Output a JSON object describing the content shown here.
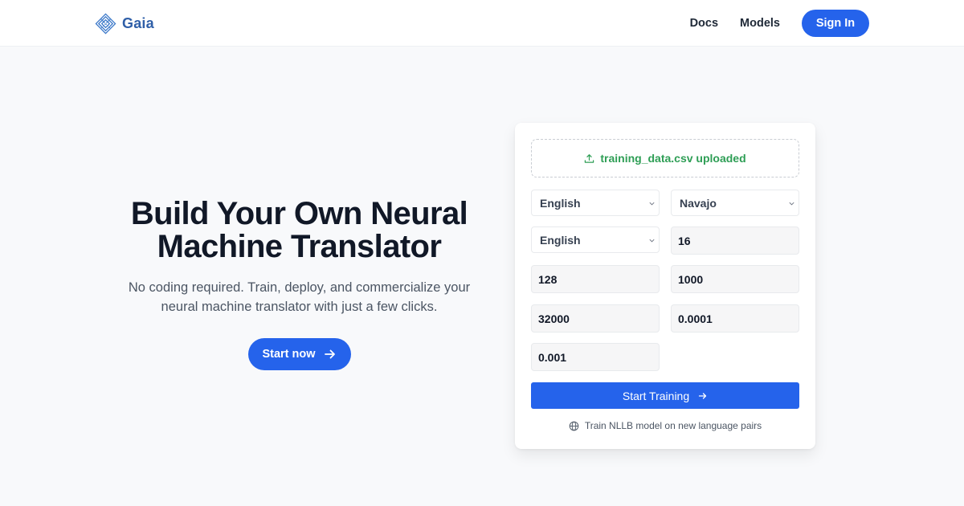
{
  "navbar": {
    "brand": {
      "name": "Gaia",
      "icon": "diamond-grid-logo-icon",
      "color": "#2f5fa8"
    },
    "links": [
      {
        "label": "Docs"
      },
      {
        "label": "Models"
      }
    ],
    "signin_label": "Sign In"
  },
  "hero": {
    "title_line1": "Build Your Own Neural",
    "title_line2": "Machine Translator",
    "subtitle_line1": "No coding required. Train, deploy, and commercialize your",
    "subtitle_line2": "neural machine translator with just a few clicks.",
    "cta_label": "Start now",
    "cta_icon": "arrow-right-icon"
  },
  "training_form": {
    "upload": {
      "icon": "upload-icon",
      "status": "training_data.csv uploaded",
      "color": "#2e9e55"
    },
    "selects": {
      "source_language": "English",
      "target_language": "Navajo",
      "pivot_language": "English"
    },
    "inputs": [
      {
        "name": "param-1",
        "value": "16"
      },
      {
        "name": "param-2",
        "value": "128"
      },
      {
        "name": "param-3",
        "value": "1000"
      },
      {
        "name": "param-4",
        "value": "32000"
      },
      {
        "name": "param-5",
        "value": "0.0001"
      },
      {
        "name": "param-6",
        "value": "0.001"
      }
    ],
    "submit_label": "Start Training",
    "submit_icon": "arrow-right-icon",
    "footnote": "Train NLLB model on new language pairs",
    "footnote_icon": "globe-icon"
  },
  "colors": {
    "accent": "#2563eb",
    "background": "#f8f9fb",
    "success": "#2e9e55"
  }
}
